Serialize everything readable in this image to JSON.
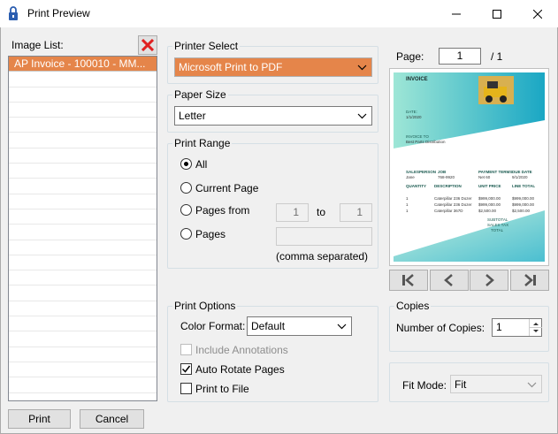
{
  "window": {
    "title": "Print Preview"
  },
  "image_list": {
    "label": "Image List:",
    "items": [
      "AP Invoice - 100010  - MM..."
    ]
  },
  "printer_select": {
    "label": "Printer Select",
    "value": "Microsoft Print to PDF"
  },
  "paper_size": {
    "label": "Paper Size",
    "value": "Letter"
  },
  "print_range": {
    "label": "Print Range",
    "all_label": "All",
    "current_page_label": "Current Page",
    "pages_from_label": "Pages from",
    "from_value": "1",
    "to_label": "to",
    "to_value": "1",
    "pages_label": "Pages",
    "pages_value": "",
    "pages_hint": "(comma separated)",
    "selected": "All"
  },
  "print_options": {
    "label": "Print Options",
    "color_format_label": "Color Format:",
    "color_format_value": "Default",
    "include_annotations_label": "Include Annotations",
    "auto_rotate_label": "Auto Rotate Pages",
    "auto_rotate_checked": true,
    "print_to_file_label": "Print to File",
    "print_to_file_checked": false
  },
  "page_nav": {
    "page_label": "Page:",
    "current": "1",
    "total": "/ 1"
  },
  "invoice_preview": {
    "title": "INVOICE",
    "date_label": "DATE:",
    "date_value": "1/1/2020",
    "invoice_to": "INVOICE TO",
    "company": "Best Parts Distribution",
    "columns": [
      "SALESPERSON",
      "JOB",
      "PAYMENT TERMS",
      "DUE DATE"
    ],
    "row": [
      "Jane",
      "768-9920",
      "Net 60",
      "9/1/2020"
    ],
    "item_cols": [
      "QUANTITY",
      "DESCRIPTION",
      "UNIT PRICE",
      "LINE TOTAL"
    ],
    "items": [
      [
        "1",
        "Caterpillar 236 Dozer",
        "$999,000.00",
        "$999,000.00"
      ],
      [
        "1",
        "Caterpillar 236 Dozer",
        "$999,000.00",
        "$999,000.00"
      ],
      [
        "1",
        "Caterpillar 367D",
        "$2,500.00",
        "$2,500.00"
      ]
    ],
    "subtotal_label": "SUBTOTAL",
    "tax_label": "SALES TAX",
    "total_label": "TOTAL"
  },
  "copies": {
    "label": "Copies",
    "count_label": "Number of Copies:",
    "count_value": "1"
  },
  "fit_mode": {
    "label": "Fit Mode:",
    "value": "Fit"
  },
  "buttons": {
    "print": "Print",
    "cancel": "Cancel"
  }
}
